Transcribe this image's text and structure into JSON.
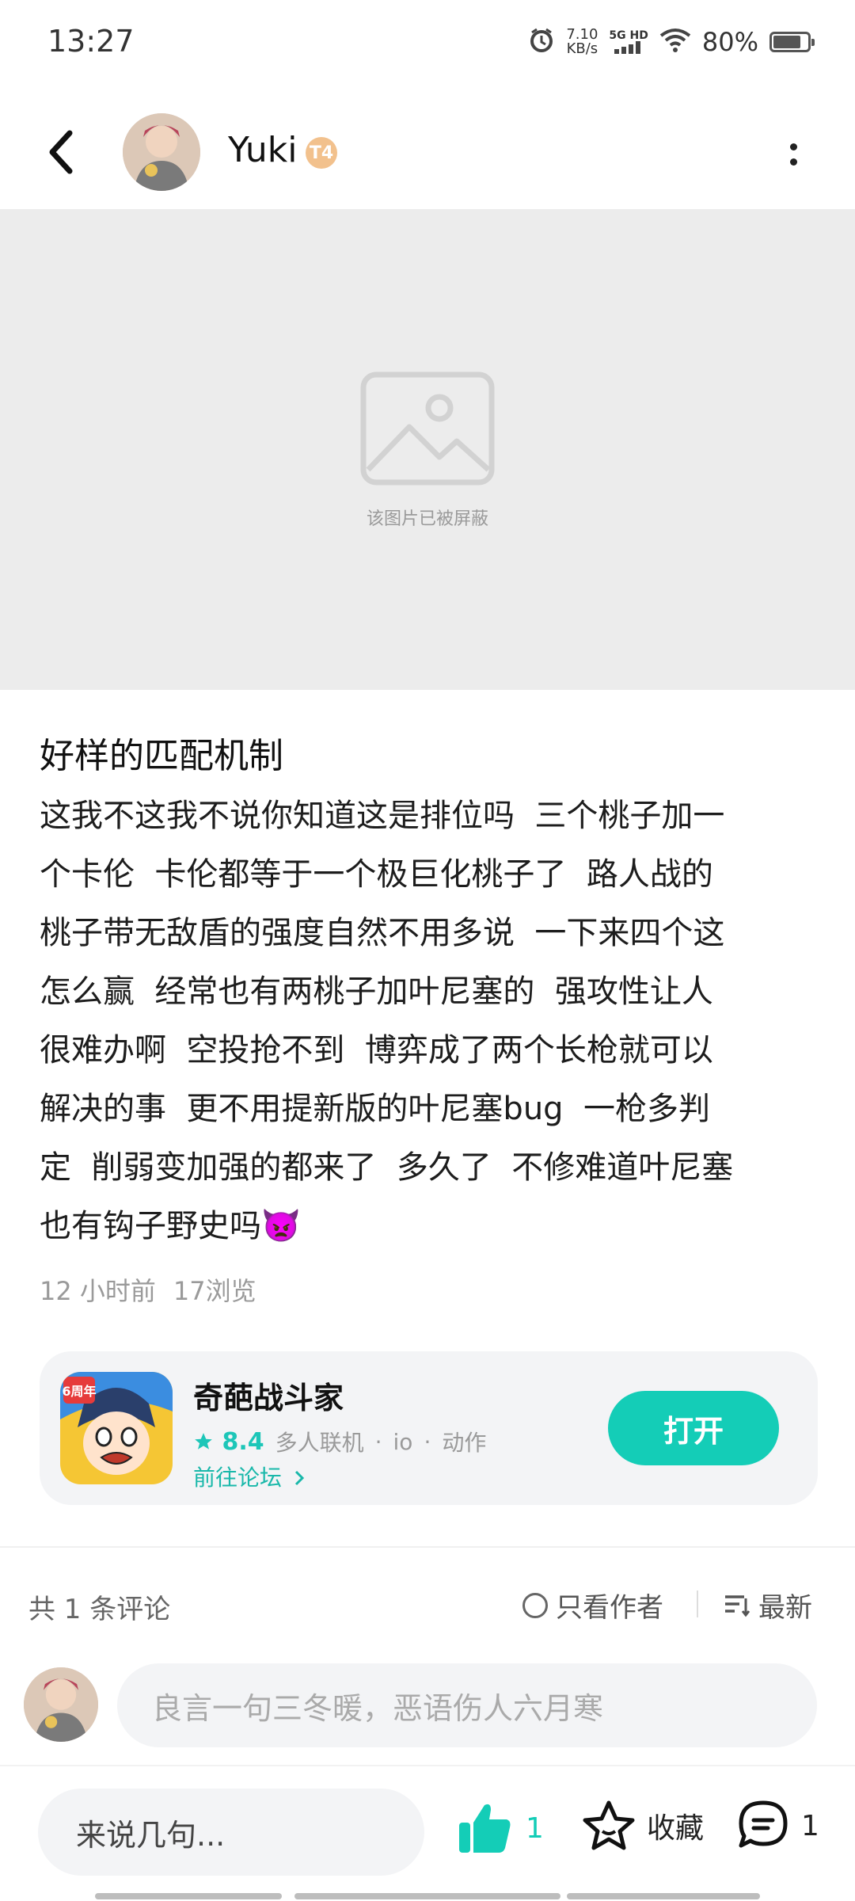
{
  "status_bar": {
    "time": "13:27",
    "net_speed_value": "7.10",
    "net_speed_unit": "KB/s",
    "signal_label": "5G HD",
    "battery": "80%",
    "battery_level": 0.8
  },
  "header": {
    "username": "Yuki",
    "level_badge": "T4"
  },
  "blocked_image": {
    "text": "该图片已被屏蔽"
  },
  "post": {
    "title": "好样的匹配机制",
    "body": "这我不这我不说你知道这是排位吗  三个桃子加一\n个卡伦  卡伦都等于一个极巨化桃子了  路人战的\n桃子带无敌盾的强度自然不用多说  一下来四个这\n怎么赢  经常也有两桃子加叶尼塞的  强攻性让人\n很难办啊  空投抢不到  博弈成了两个长枪就可以\n解决的事  更不用提新版的叶尼塞bug  一枪多判\n定  削弱变加强的都来了  多久了  不修难道叶尼塞\n也有钩子野史吗👿",
    "time_ago": "12 小时前",
    "views": "17浏览"
  },
  "game_card": {
    "name": "奇葩战斗家",
    "rating": "8.4",
    "tags": [
      "多人联机",
      "io",
      "动作"
    ],
    "forum_link": "前往论坛",
    "open_label": "打开",
    "anniversary_badge": "6周年",
    "accent": "#14cdb7"
  },
  "comments": {
    "count_label": "共 1 条评论",
    "author_only_label": "只看作者",
    "sort_label": "最新",
    "input_placeholder": "良言一句三冬暖，恶语伤人六月寒"
  },
  "bottom_bar": {
    "reply_placeholder": "来说几句...",
    "like_count": "1",
    "favorite_label": "收藏",
    "comment_count": "1"
  }
}
